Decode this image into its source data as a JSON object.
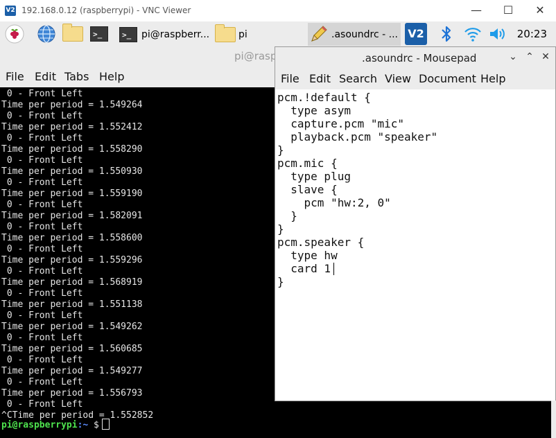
{
  "vnc": {
    "logo": "V2",
    "title": "192.168.0.12 (raspberrypi) - VNC Viewer",
    "buttons": [
      "minimize-icon",
      "maximize-icon",
      "close-icon"
    ]
  },
  "taskbar": {
    "icons": [
      "raspberry-menu-icon",
      "web-browser-icon",
      "file-manager-icon",
      "terminal-icon"
    ],
    "tasks": [
      {
        "icon": "terminal-icon",
        "label": "pi@raspberr..."
      },
      {
        "icon": "folder-icon",
        "label": "pi"
      },
      {
        "icon": "text-editor-icon",
        "label": ".asoundrc - ..."
      }
    ],
    "tray": [
      "vnc-server-icon",
      "bluetooth-icon",
      "wifi-icon",
      "volume-icon"
    ],
    "clock": "20:23"
  },
  "terminal": {
    "title": "pi@rasp",
    "menu": [
      "File",
      "Edit",
      "Tabs",
      "Help"
    ],
    "lines": [
      " 0 - Front Left",
      "Time per period = 1.549264",
      " 0 - Front Left",
      "Time per period = 1.552412",
      " 0 - Front Left",
      "Time per period = 1.558290",
      " 0 - Front Left",
      "Time per period = 1.550930",
      " 0 - Front Left",
      "Time per period = 1.559190",
      " 0 - Front Left",
      "Time per period = 1.582091",
      " 0 - Front Left",
      "Time per period = 1.558600",
      " 0 - Front Left",
      "Time per period = 1.559296",
      " 0 - Front Left",
      "Time per period = 1.568919",
      " 0 - Front Left",
      "Time per period = 1.551138",
      " 0 - Front Left",
      "Time per period = 1.549262",
      " 0 - Front Left",
      "Time per period = 1.560685",
      " 0 - Front Left",
      "Time per period = 1.549277",
      " 0 - Front Left",
      "Time per period = 1.556793",
      " 0 - Front Left",
      "^CTime per period = 1.552852"
    ],
    "prompt": {
      "user": "pi@raspberrypi",
      "path": ":~",
      "symbol": " $"
    }
  },
  "mousepad": {
    "title": ".asoundrc - Mousepad",
    "menu": [
      "File",
      "Edit",
      "Search",
      "View",
      "Document",
      "Help"
    ],
    "content": [
      "pcm.!default {",
      "  type asym",
      "  capture.pcm \"mic\"",
      "  playback.pcm \"speaker\"",
      "}",
      "pcm.mic {",
      "  type plug",
      "  slave {",
      "    pcm \"hw:2, 0\"",
      "  }",
      "}",
      "pcm.speaker {",
      "  type hw",
      "  card 1",
      "}"
    ]
  },
  "colors": {
    "prompt_user": "#4ee34e",
    "prompt_path": "#5c8dff",
    "bluetooth": "#1e73d6",
    "wifi": "#1e9be9"
  }
}
